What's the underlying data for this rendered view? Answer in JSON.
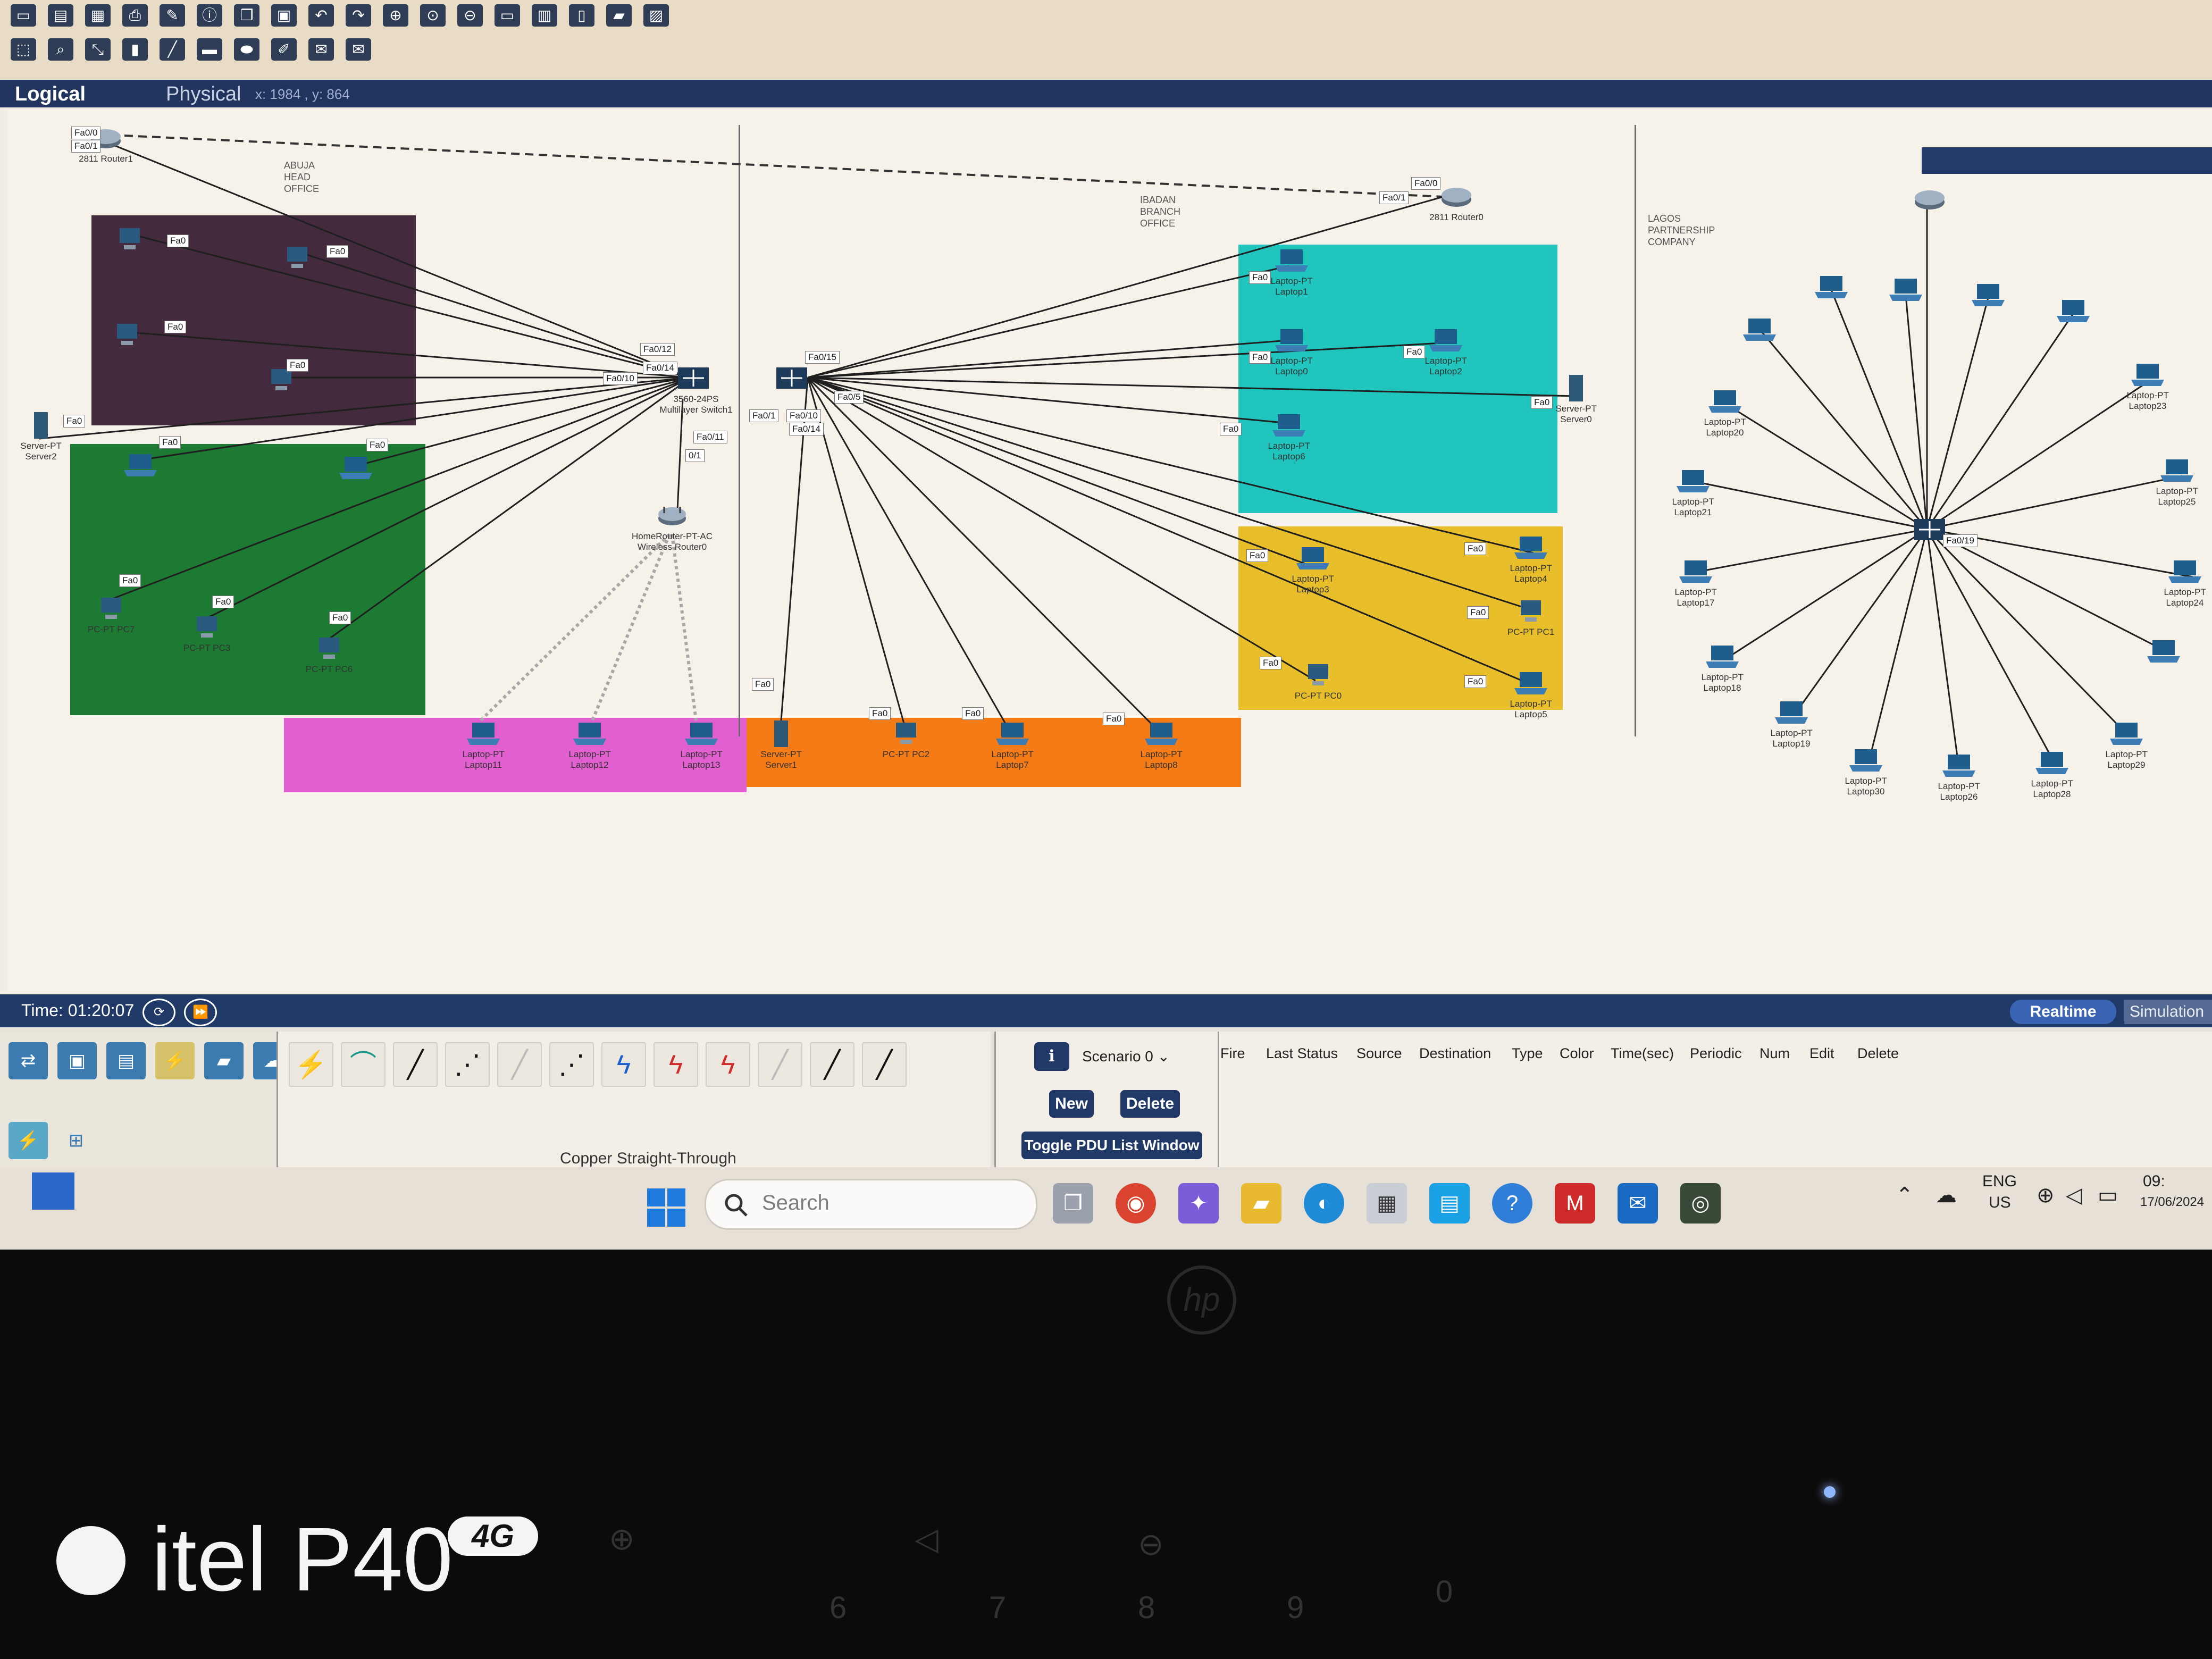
{
  "colors": {
    "head_office_purple": "#432a3d",
    "head_office_green": "#1d7a33",
    "magenta": "#e25fcf",
    "orange": "#f47b16",
    "cyan": "#20c6bd",
    "yellow": "#e8be2a",
    "taskbar": "#e6e0d6",
    "link": "#1f1f1f",
    "wireless": "#a7a7a7"
  },
  "tabs": {
    "logical": "Logical",
    "physical": "Physical",
    "coords": "x: 1984 , y: 864"
  },
  "zones": {
    "abuja": "ABUJA HEAD OFFICE",
    "ibadan": "IBADAN BRANCH OFFICE",
    "lagos": "LAGOS PARTNERSHIP COMPANY"
  },
  "devices": {
    "router1": {
      "model": "2811",
      "name": "Router1"
    },
    "router0": {
      "model": "2811",
      "name": "Router0"
    },
    "mls": {
      "model": "3560-24PS",
      "name": "Multilayer Switch1"
    },
    "wrouter": {
      "model": "HomeRouter-PT-AC",
      "name": "Wireless Router0"
    },
    "server2": {
      "model": "Server-PT",
      "name": "Server2"
    },
    "server0": {
      "model": "Server-PT",
      "name": "Server0"
    },
    "server1": {
      "model": "Server-PT",
      "name": "Server1"
    },
    "pc0": {
      "model": "PC-PT",
      "name": "PC0"
    },
    "pc1": {
      "model": "PC-PT",
      "name": "PC1"
    },
    "pc2": {
      "model": "PC-PT",
      "name": "PC2"
    },
    "pc3": {
      "model": "PC-PT",
      "name": "PC3"
    },
    "pc6": {
      "model": "PC-PT",
      "name": "PC6"
    },
    "pc7": {
      "model": "PC-PT",
      "name": "PC7"
    },
    "laptop0": {
      "model": "Laptop-PT",
      "name": "Laptop0"
    },
    "laptop1": {
      "model": "Laptop-PT",
      "name": "Laptop1"
    },
    "laptop2": {
      "model": "Laptop-PT",
      "name": "Laptop2"
    },
    "laptop3": {
      "model": "Laptop-PT",
      "name": "Laptop3"
    },
    "laptop4": {
      "model": "Laptop-PT",
      "name": "Laptop4"
    },
    "laptop5": {
      "model": "Laptop-PT",
      "name": "Laptop5"
    },
    "laptop6": {
      "model": "Laptop-PT",
      "name": "Laptop6"
    },
    "laptop7": {
      "model": "Laptop-PT",
      "name": "Laptop7"
    },
    "laptop8": {
      "model": "Laptop-PT",
      "name": "Laptop8"
    },
    "laptop11": {
      "model": "Laptop-PT",
      "name": "Laptop11"
    },
    "laptop12": {
      "model": "Laptop-PT",
      "name": "Laptop12"
    },
    "laptop13": {
      "model": "Laptop-PT",
      "name": "Laptop13"
    },
    "laptop17": {
      "model": "Laptop-PT",
      "name": "Laptop17"
    },
    "laptop18": {
      "model": "Laptop-PT",
      "name": "Laptop18"
    },
    "laptop19": {
      "model": "Laptop-PT",
      "name": "Laptop19"
    },
    "laptop20": {
      "model": "Laptop-PT",
      "name": "Laptop20"
    },
    "laptop21": {
      "model": "Laptop-PT",
      "name": "Laptop21"
    },
    "laptop23": {
      "model": "Laptop-PT",
      "name": "Laptop23"
    },
    "laptop24": {
      "model": "Laptop-PT",
      "name": "Laptop24"
    },
    "laptop25": {
      "model": "Laptop-PT",
      "name": "Laptop25"
    },
    "laptop26": {
      "model": "Laptop-PT",
      "name": "Laptop26"
    },
    "laptop28": {
      "model": "Laptop-PT",
      "name": "Laptop28"
    },
    "laptop29": {
      "model": "Laptop-PT",
      "name": "Laptop29"
    },
    "laptop30": {
      "model": "Laptop-PT",
      "name": "Laptop30"
    }
  },
  "ports": {
    "fa0": "Fa0",
    "fa00": "Fa0/0",
    "fa01": "Fa0/1",
    "fa010": "Fa0/10",
    "fa011": "Fa0/11",
    "fa012": "Fa0/12",
    "fa014": "Fa0/14",
    "fa015": "Fa0/15",
    "fa05": "Fa0/5",
    "zero_one": "0/1",
    "fa019": "Fa0/19"
  },
  "status": {
    "time_label": "Time: 01:20:07",
    "realtime": "Realtime",
    "simulation": "Simulation"
  },
  "pdu": {
    "scenario": "Scenario 0",
    "new": "New",
    "delete": "Delete",
    "toggle": "Toggle PDU List Window"
  },
  "pdu_table": {
    "headers": [
      "Fire",
      "Last Status",
      "Source",
      "Destination",
      "Type",
      "Color",
      "Time(sec)",
      "Periodic",
      "Num",
      "Edit",
      "Delete"
    ]
  },
  "connection": {
    "label": "Copper Straight-Through"
  },
  "taskbar": {
    "search_placeholder": "Search",
    "lang": "ENG",
    "region": "US",
    "date": "17/06/2024",
    "clock": "09:"
  },
  "laptop_brand": "hp",
  "watermark": {
    "model": "itel P40",
    "badge": "4G"
  },
  "icons": {
    "search": "search-icon",
    "start": "windows-start-icon",
    "play": "fast-forward-icon",
    "power": "power-cycle-icon"
  }
}
